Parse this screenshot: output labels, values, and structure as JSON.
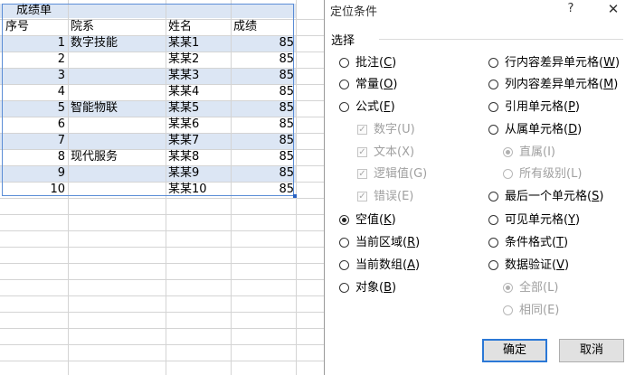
{
  "sheet": {
    "title": "成绩单",
    "headers": [
      "序号",
      "院系",
      "姓名",
      "成绩"
    ],
    "rows": [
      {
        "no": "1",
        "dept": "数字技能",
        "name": "某某1",
        "score": "85"
      },
      {
        "no": "2",
        "dept": "",
        "name": "某某2",
        "score": "85"
      },
      {
        "no": "3",
        "dept": "",
        "name": "某某3",
        "score": "85"
      },
      {
        "no": "4",
        "dept": "",
        "name": "某某4",
        "score": "85"
      },
      {
        "no": "5",
        "dept": "智能物联",
        "name": "某某5",
        "score": "85"
      },
      {
        "no": "6",
        "dept": "",
        "name": "某某6",
        "score": "85"
      },
      {
        "no": "7",
        "dept": "",
        "name": "某某7",
        "score": "85"
      },
      {
        "no": "8",
        "dept": "现代服务",
        "name": "某某8",
        "score": "85"
      },
      {
        "no": "9",
        "dept": "",
        "name": "某某9",
        "score": "85"
      },
      {
        "no": "10",
        "dept": "",
        "name": "某某10",
        "score": "85"
      }
    ],
    "selection_color": "#dce6f4"
  },
  "dialog": {
    "title": "定位条件",
    "help": "?",
    "close": "✕",
    "group_label": "选择",
    "left": {
      "comments": {
        "text": "批注(",
        "key": "C",
        "end": ")"
      },
      "constants": {
        "text": "常量(",
        "key": "O",
        "end": ")"
      },
      "formulas": {
        "text": "公式(",
        "key": "F",
        "end": ")"
      },
      "numbers": {
        "text": "数字(U)"
      },
      "text": {
        "text": "文本(X)"
      },
      "logicals": {
        "text": "逻辑值(G)"
      },
      "errors": {
        "text": "错误(E)"
      },
      "blanks": {
        "text": "空值(",
        "key": "K",
        "end": ")"
      },
      "current_region": {
        "text": "当前区域(",
        "key": "R",
        "end": ")"
      },
      "current_array": {
        "text": "当前数组(",
        "key": "A",
        "end": ")"
      },
      "objects": {
        "text": "对象(",
        "key": "B",
        "end": ")"
      }
    },
    "right": {
      "row_diff": {
        "text": "行内容差异单元格(",
        "key": "W",
        "end": ")"
      },
      "col_diff": {
        "text": "列内容差异单元格(",
        "key": "M",
        "end": ")"
      },
      "precedents": {
        "text": "引用单元格(",
        "key": "P",
        "end": ")"
      },
      "dependents": {
        "text": "从属单元格(",
        "key": "D",
        "end": ")"
      },
      "direct_only": {
        "text": "直属(I)"
      },
      "all_levels": {
        "text": "所有级别(L)"
      },
      "last_cell": {
        "text": "最后一个单元格(",
        "key": "S",
        "end": ")"
      },
      "visible": {
        "text": "可见单元格(",
        "key": "Y",
        "end": ")"
      },
      "cond_formats": {
        "text": "条件格式(",
        "key": "T",
        "end": ")"
      },
      "data_validation": {
        "text": "数据验证(",
        "key": "V",
        "end": ")"
      },
      "dv_all": {
        "text": "全部(L)"
      },
      "dv_same": {
        "text": "相同(E)"
      }
    },
    "ok_label": "确定",
    "cancel_label": "取消",
    "selected_option": "空值(K)",
    "accent_color": "#2b78d6"
  }
}
